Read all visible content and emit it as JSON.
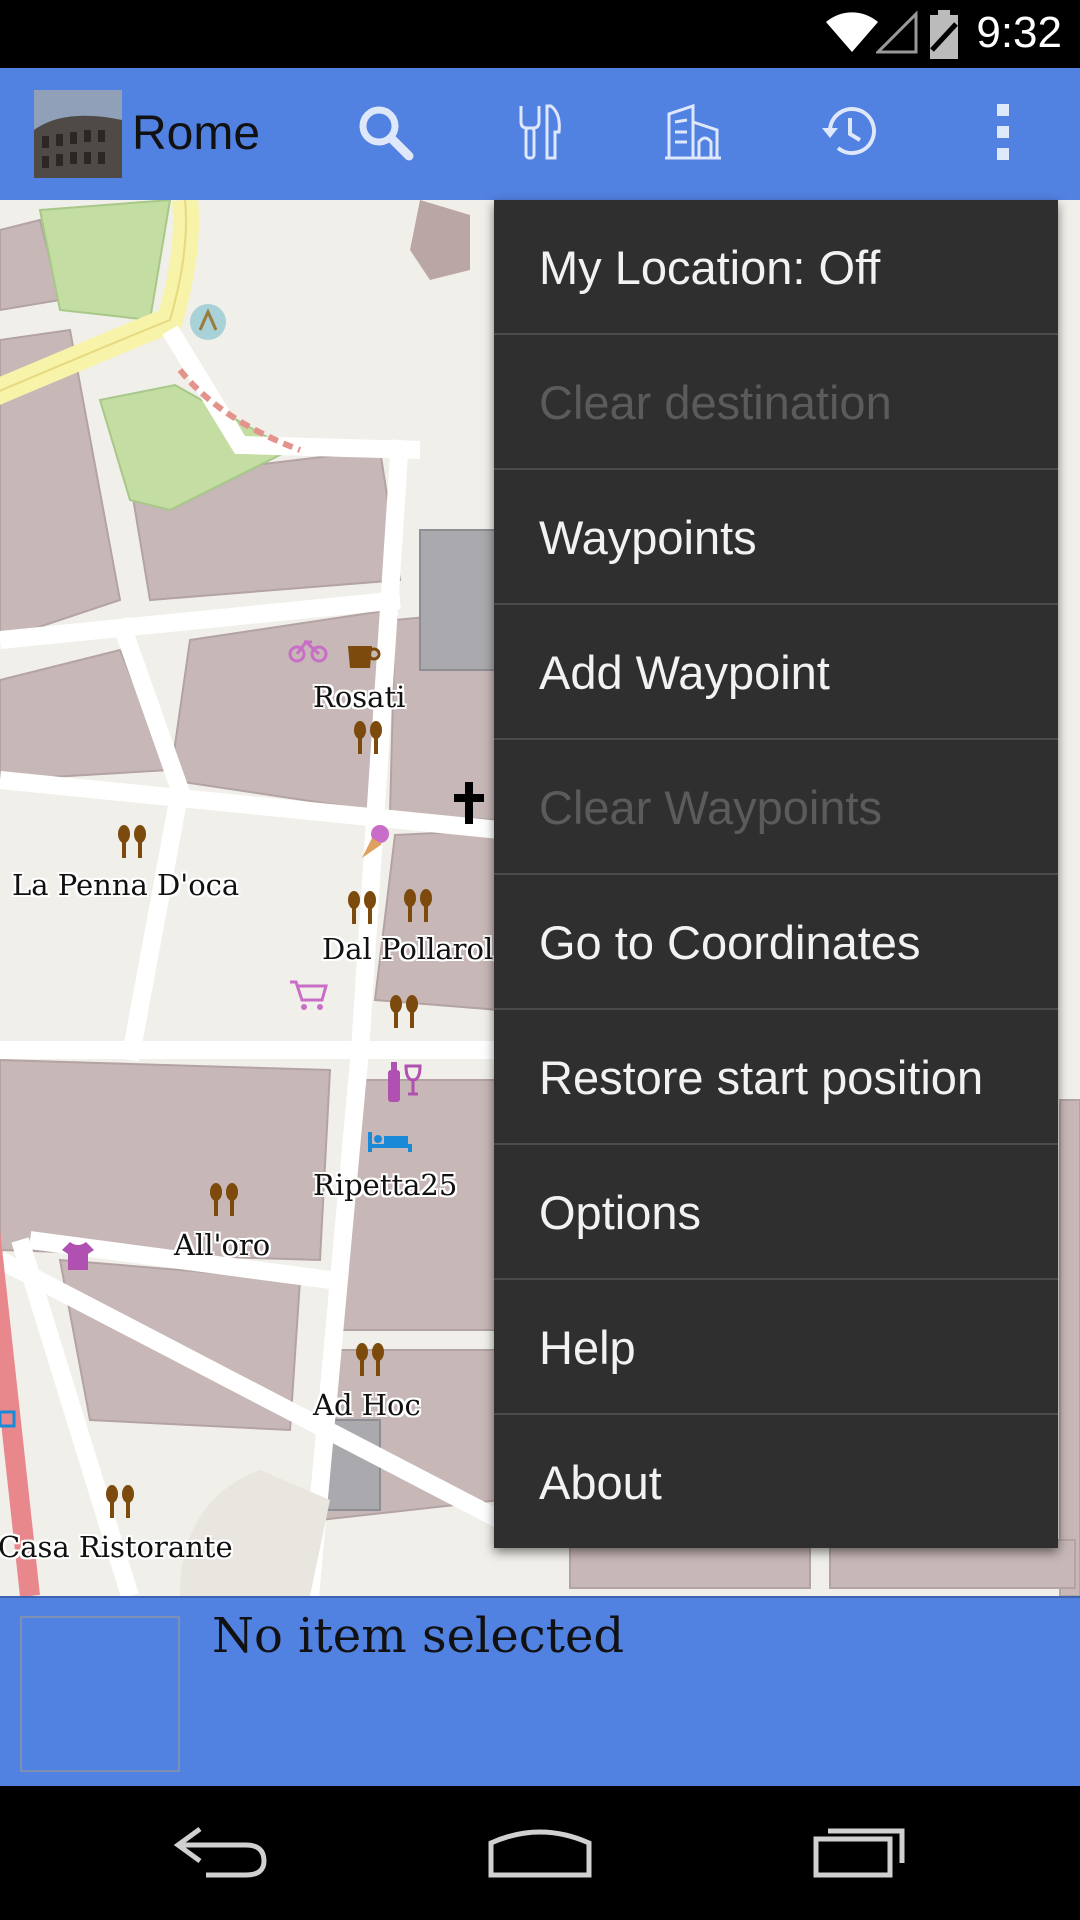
{
  "status_bar": {
    "time": "9:32",
    "icons": [
      "wifi-icon",
      "signal-icon",
      "battery-icon"
    ]
  },
  "action_bar": {
    "title": "Rome",
    "actions": [
      "search-icon",
      "restaurant-icon",
      "building-icon",
      "history-icon",
      "overflow-menu-icon"
    ],
    "accent": "#5181e1"
  },
  "map": {
    "labels": {
      "rosati": "Rosati",
      "la_penna": "La Penna D'oca",
      "dal_pollarola": "Dal Pollarol",
      "ripetta": "Ripetta25",
      "alloro": "All'oro",
      "ad_hoc": "Ad Hoc",
      "casa": "Casa Ristorante"
    }
  },
  "menu": {
    "items": [
      {
        "label": "My Location: Off",
        "enabled": true
      },
      {
        "label": "Clear destination",
        "enabled": false
      },
      {
        "label": "Waypoints",
        "enabled": true
      },
      {
        "label": "Add Waypoint",
        "enabled": true
      },
      {
        "label": "Clear Waypoints",
        "enabled": false
      },
      {
        "label": "Go to Coordinates",
        "enabled": true
      },
      {
        "label": "Restore start position",
        "enabled": true
      },
      {
        "label": "Options",
        "enabled": true
      },
      {
        "label": "Help",
        "enabled": true
      },
      {
        "label": "About",
        "enabled": true
      }
    ],
    "background": "#2f2f2f"
  },
  "info_panel": {
    "text": "No item selected"
  },
  "nav_bar": {
    "buttons": [
      "back-icon",
      "home-icon",
      "recents-icon"
    ]
  }
}
